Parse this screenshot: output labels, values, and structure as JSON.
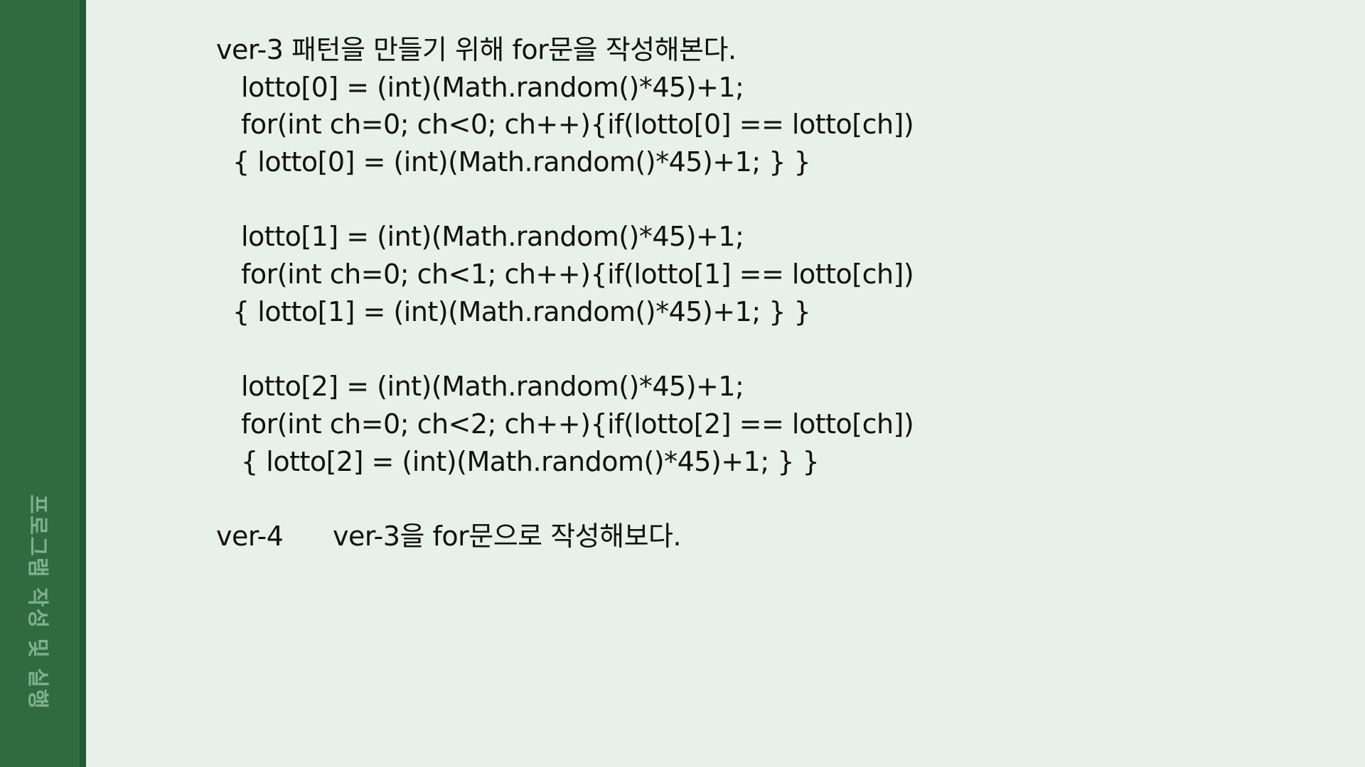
{
  "sidebar": {
    "label": "프로그램 작성 및 실행",
    "bg_color": "#2f6b3f",
    "label_color": "#7fb08b"
  },
  "content": {
    "heading_ver3": "ver-3 패턴을 만들기 위해 for문을 작성해본다.",
    "blocks": [
      {
        "line1": "lotto[0] = (int)(Math.random()*45)+1;",
        "line2": "for(int ch=0; ch<0; ch++){if(lotto[0] == lotto[ch])",
        "line3": "{ lotto[0] = (int)(Math.random()*45)+1; } }"
      },
      {
        "line1": "lotto[1] = (int)(Math.random()*45)+1;",
        "line2": "for(int ch=0; ch<1; ch++){if(lotto[1] == lotto[ch])",
        "line3": "{ lotto[1] = (int)(Math.random()*45)+1; } }"
      },
      {
        "line1": "lotto[2] = (int)(Math.random()*45)+1;",
        "line2": "for(int ch=0; ch<2; ch++){if(lotto[2] == lotto[ch])",
        "line3": "{ lotto[2] = (int)(Math.random()*45)+1; } }"
      }
    ],
    "ver4_tag": "ver-4",
    "ver4_text": "ver-3을 for문으로 작성해보다."
  }
}
